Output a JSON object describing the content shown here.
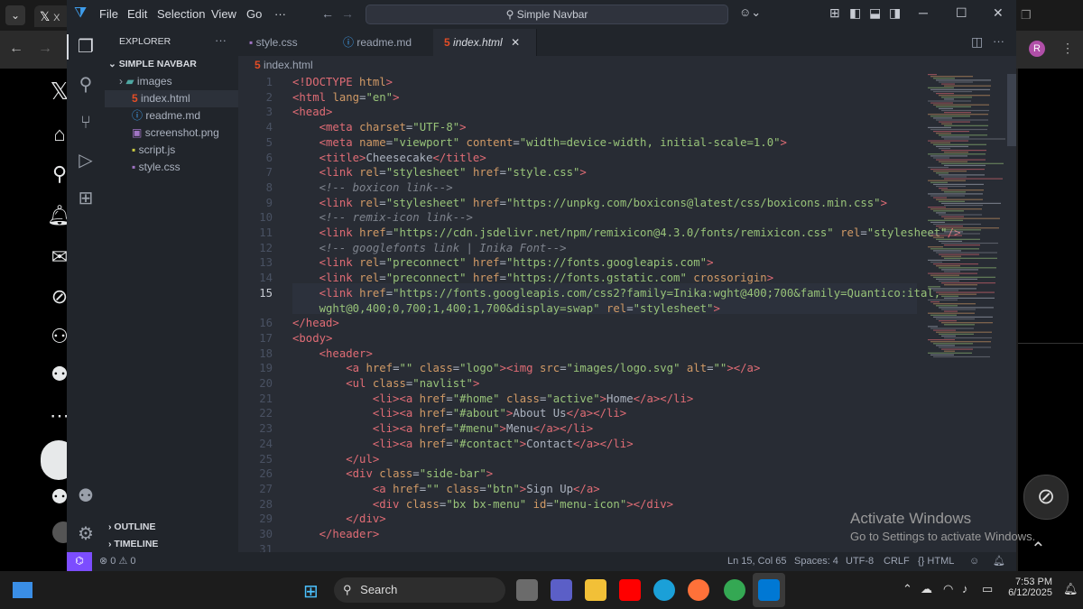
{
  "browser": {
    "tab_title": "X",
    "right_icon": "ⓡ"
  },
  "titlebar": {
    "menu": [
      "File",
      "Edit",
      "Selection",
      "View",
      "Go",
      "···"
    ],
    "search_text": "Simple Navbar"
  },
  "sidebar": {
    "header": "EXPLORER",
    "folder": "SIMPLE NAVBAR",
    "items": [
      {
        "label": "images",
        "icon": "folder-icon",
        "color": "#4fa8a3"
      },
      {
        "label": "index.html",
        "icon": "html-icon",
        "color": "#e44d26"
      },
      {
        "label": "readme.md",
        "icon": "info-icon",
        "color": "#42a5f5"
      },
      {
        "label": "screenshot.png",
        "icon": "image-icon",
        "color": "#a074c4"
      },
      {
        "label": "script.js",
        "icon": "js-icon",
        "color": "#cbcb41"
      },
      {
        "label": "style.css",
        "icon": "css-icon",
        "color": "#a074c4"
      }
    ],
    "outline": "OUTLINE",
    "timeline": "TIMELINE"
  },
  "tabs": [
    {
      "label": "style.css",
      "icon": "css-icon",
      "active": false
    },
    {
      "label": "readme.md",
      "icon": "info-icon",
      "active": false
    },
    {
      "label": "index.html",
      "icon": "html-icon",
      "active": true
    }
  ],
  "breadcrumb": "index.html",
  "code_lines": [
    {
      "n": "1",
      "html": "<span class='tg'>&lt;!DOCTYPE</span> <span class='at'>html</span><span class='tg'>&gt;</span>"
    },
    {
      "n": "2",
      "html": "<span class='tg'>&lt;html</span> <span class='at'>lang</span>=<span class='st'>\"en\"</span><span class='tg'>&gt;</span>"
    },
    {
      "n": "3",
      "html": "<span class='tg'>&lt;head&gt;</span>"
    },
    {
      "n": "4",
      "html": "    <span class='tg'>&lt;meta</span> <span class='at'>charset</span>=<span class='st'>\"UTF-8\"</span><span class='tg'>&gt;</span>"
    },
    {
      "n": "5",
      "html": "    <span class='tg'>&lt;meta</span> <span class='at'>name</span>=<span class='st'>\"viewport\"</span> <span class='at'>content</span>=<span class='st'>\"width=device-width, initial-scale=1.0\"</span><span class='tg'>&gt;</span>"
    },
    {
      "n": "6",
      "html": "    <span class='tg'>&lt;title&gt;</span>Cheesecake<span class='tg'>&lt;/title&gt;</span>"
    },
    {
      "n": "7",
      "html": "    <span class='tg'>&lt;link</span> <span class='at'>rel</span>=<span class='st'>\"stylesheet\"</span> <span class='at'>href</span>=<span class='st'>\"style.css\"</span><span class='tg'>&gt;</span>"
    },
    {
      "n": "8",
      "html": "    <span class='cm'>&lt;!-- boxicon link--&gt;</span>"
    },
    {
      "n": "9",
      "html": "    <span class='tg'>&lt;link</span> <span class='at'>rel</span>=<span class='st'>\"stylesheet\"</span> <span class='at'>href</span>=<span class='st'>\"https://unpkg.com/boxicons@latest/css/boxicons.min.css\"</span><span class='tg'>&gt;</span>"
    },
    {
      "n": "10",
      "html": "    <span class='cm'>&lt;!-- remix-icon link--&gt;</span>"
    },
    {
      "n": "11",
      "html": "    <span class='tg'>&lt;link</span> <span class='at'>href</span>=<span class='st'>\"https://cdn.jsdelivr.net/npm/remixicon@4.3.0/fonts/remixicon.css\"</span> <span class='at'>rel</span>=<span class='st'>\"stylesheet\"</span><span class='tg'>/&gt;</span>"
    },
    {
      "n": "12",
      "html": "    <span class='cm'>&lt;!-- googlefonts link | Inika Font--&gt;</span>"
    },
    {
      "n": "13",
      "html": "    <span class='tg'>&lt;link</span> <span class='at'>rel</span>=<span class='st'>\"preconnect\"</span> <span class='at'>href</span>=<span class='st'>\"https://fonts.googleapis.com\"</span><span class='tg'>&gt;</span>"
    },
    {
      "n": "14",
      "html": "    <span class='tg'>&lt;link</span> <span class='at'>rel</span>=<span class='st'>\"preconnect\"</span> <span class='at'>href</span>=<span class='st'>\"https://fonts.gstatic.com\"</span> <span class='at'>crossorigin</span><span class='tg'>&gt;</span>"
    },
    {
      "n": "15",
      "html": "    <span class='tg'>&lt;link</span> <span class='at'>href</span>=<span class='st'>\"https://fonts.googleapis.com/css2?family=Inika:wght@400;700&amp;family=Quantico:ital,</span>"
    },
    {
      "n": "",
      "html": "    <span class='st'>wght@0,400;0,700;1,400;1,700&amp;display=swap\"</span> <span class='at'>rel</span>=<span class='st'>\"stylesheet\"</span><span class='tg'>&gt;</span>"
    },
    {
      "n": "16",
      "html": "<span class='tg'>&lt;/head&gt;</span>"
    },
    {
      "n": "17",
      "html": "<span class='tg'>&lt;body&gt;</span>"
    },
    {
      "n": "18",
      "html": "    <span class='tg'>&lt;header&gt;</span>"
    },
    {
      "n": "19",
      "html": "        <span class='tg'>&lt;a</span> <span class='at'>href</span>=<span class='st'>\"\"</span> <span class='at'>class</span>=<span class='st'>\"logo\"</span><span class='tg'>&gt;&lt;img</span> <span class='at'>src</span>=<span class='st'>\"images/logo.svg\"</span> <span class='at'>alt</span>=<span class='st'>\"\"</span><span class='tg'>&gt;&lt;/a&gt;</span>"
    },
    {
      "n": "20",
      "html": "        <span class='tg'>&lt;ul</span> <span class='at'>class</span>=<span class='st'>\"navlist\"</span><span class='tg'>&gt;</span>"
    },
    {
      "n": "21",
      "html": "            <span class='tg'>&lt;li&gt;&lt;a</span> <span class='at'>href</span>=<span class='st'>\"#home\"</span> <span class='at'>class</span>=<span class='st'>\"active\"</span><span class='tg'>&gt;</span>Home<span class='tg'>&lt;/a&gt;&lt;/li&gt;</span>"
    },
    {
      "n": "22",
      "html": "            <span class='tg'>&lt;li&gt;&lt;a</span> <span class='at'>href</span>=<span class='st'>\"#about\"</span><span class='tg'>&gt;</span>About Us<span class='tg'>&lt;/a&gt;&lt;/li&gt;</span>"
    },
    {
      "n": "23",
      "html": "            <span class='tg'>&lt;li&gt;&lt;a</span> <span class='at'>href</span>=<span class='st'>\"#menu\"</span><span class='tg'>&gt;</span>Menu<span class='tg'>&lt;/a&gt;&lt;/li&gt;</span>"
    },
    {
      "n": "24",
      "html": "            <span class='tg'>&lt;li&gt;&lt;a</span> <span class='at'>href</span>=<span class='st'>\"#contact\"</span><span class='tg'>&gt;</span>Contact<span class='tg'>&lt;/a&gt;&lt;/li&gt;</span>"
    },
    {
      "n": "25",
      "html": "        <span class='tg'>&lt;/ul&gt;</span>"
    },
    {
      "n": "26",
      "html": "        <span class='tg'>&lt;div</span> <span class='at'>class</span>=<span class='st'>\"side-bar\"</span><span class='tg'>&gt;</span>"
    },
    {
      "n": "27",
      "html": "            <span class='tg'>&lt;a</span> <span class='at'>href</span>=<span class='st'>\"\"</span> <span class='at'>class</span>=<span class='st'>\"btn\"</span><span class='tg'>&gt;</span>Sign Up<span class='tg'>&lt;/a&gt;</span>"
    },
    {
      "n": "28",
      "html": "            <span class='tg'>&lt;div</span> <span class='at'>class</span>=<span class='st'>\"bx bx-menu\"</span> <span class='at'>id</span>=<span class='st'>\"menu-icon\"</span><span class='tg'>&gt;&lt;/div&gt;</span>"
    },
    {
      "n": "29",
      "html": "        <span class='tg'>&lt;/div&gt;</span>"
    },
    {
      "n": "30",
      "html": "    <span class='tg'>&lt;/header&gt;</span>"
    },
    {
      "n": "31",
      "html": ""
    }
  ],
  "statusbar": {
    "remote": "⌬",
    "problems": "⊗ 0 ⚠ 0",
    "position": "Ln 15, Col 65",
    "spaces": "Spaces: 4",
    "encoding": "UTF-8",
    "eol": "CRLF",
    "language": "{} HTML"
  },
  "watermark": {
    "title": "Activate Windows",
    "subtitle": "Go to Settings to activate Windows."
  },
  "taskbar": {
    "search": "Search",
    "time": "7:53 PM",
    "date": "6/12/2025"
  },
  "colors": {
    "accent": "#4d78cc",
    "statusbar_remote": "#7c4dff"
  }
}
